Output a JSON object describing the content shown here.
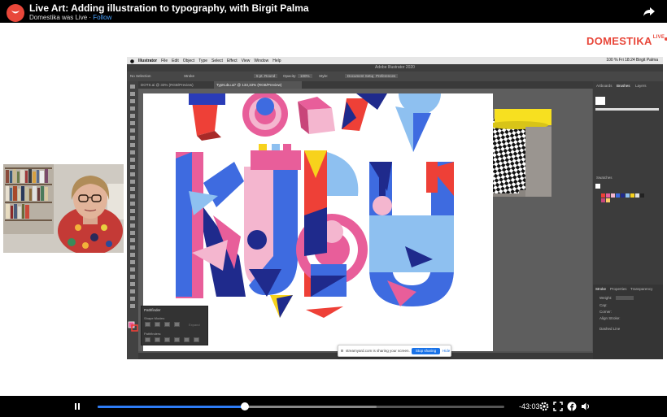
{
  "video": {
    "title": "Live Art: Adding illustration to typography, with Birgit Palma",
    "subtitle_prefix": "Domestika was Live · ",
    "follow_label": "Follow"
  },
  "brand": {
    "name": "DOMESTIKA",
    "badge": "LIVE"
  },
  "illustrator": {
    "menu": [
      "Illustrator",
      "File",
      "Edit",
      "Object",
      "Type",
      "Select",
      "Effect",
      "View",
      "Window",
      "Help"
    ],
    "menu_right": "100 %   Fri 18:24   Birgit Palma",
    "window_title": "Adobe Illustrator 2020",
    "control": {
      "selection": "No Selection",
      "stroke": "Stroke",
      "uniform": "5 pt. Round",
      "opacity_label": "Opacity:",
      "opacity": "100%",
      "style": "Style:",
      "doc_setup": "Document Setup",
      "preferences": "Preferences"
    },
    "tabs": [
      "DOTS.ai @ 33% (RGB/Preview)",
      "TypKubu.ai* @ 133,33% (RGB/Preview)"
    ],
    "panels": {
      "tabs": [
        "Artboards",
        "Brushes",
        "Layers"
      ],
      "swatches": "Swatches"
    },
    "side_panel": [
      "Stroke",
      "Properties",
      "Transparency"
    ],
    "stroke_rows": [
      "Weight:",
      "Cap:",
      "Corner:",
      "Align Stroke:"
    ],
    "dashed_line": "Dashed Line",
    "pathfinder": {
      "title": "Pathfinder",
      "shape_modes": "Shape Modes:",
      "pathfinders": "Pathfinders:",
      "expand": "Expand"
    }
  },
  "share_notice": {
    "text": "streamyard.com is sharing your screen.",
    "stop_label": "Stop sharing",
    "hide_label": "Hide"
  },
  "player": {
    "remaining": "-43:03",
    "played_fraction": 0.362,
    "buffered_fraction": 0.686
  },
  "colors": {
    "accent": "#e8473a",
    "progress": "#2d7cf6",
    "pink": "#e85e9a",
    "blue": "#3e6be0",
    "navy": "#1f2a8c",
    "red": "#ee4037",
    "yellow": "#f7d21c",
    "sky": "#8ec0f0"
  }
}
